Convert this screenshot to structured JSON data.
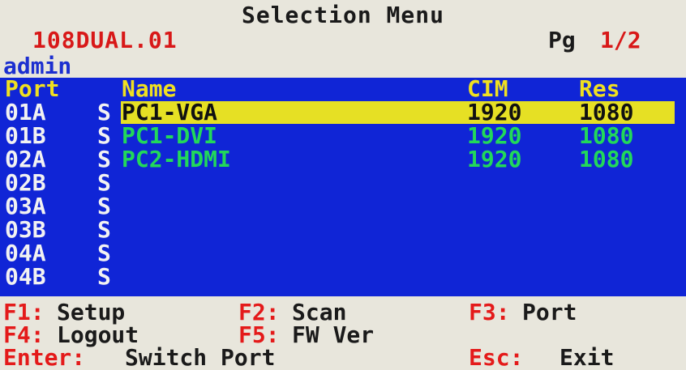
{
  "title": "Selection Menu",
  "model": "108DUAL.01",
  "page": {
    "label": "Pg",
    "value": "1/2"
  },
  "user": "admin",
  "columns": {
    "port": "Port",
    "name": "Name",
    "cim": "CIM",
    "res": "Res"
  },
  "rows": [
    {
      "port": "01A",
      "flag": "S",
      "name": "PC1-VGA",
      "cim": "1920",
      "res": "1080",
      "selected": true
    },
    {
      "port": "01B",
      "flag": "S",
      "name": "PC1-DVI",
      "cim": "1920",
      "res": "1080"
    },
    {
      "port": "02A",
      "flag": "S",
      "name": "PC2-HDMI",
      "cim": "1920",
      "res": "1080"
    },
    {
      "port": "02B",
      "flag": "S",
      "name": "",
      "cim": "",
      "res": ""
    },
    {
      "port": "03A",
      "flag": "S",
      "name": "",
      "cim": "",
      "res": ""
    },
    {
      "port": "03B",
      "flag": "S",
      "name": "",
      "cim": "",
      "res": ""
    },
    {
      "port": "04A",
      "flag": "S",
      "name": "",
      "cim": "",
      "res": ""
    },
    {
      "port": "04B",
      "flag": "S",
      "name": "",
      "cim": "",
      "res": ""
    }
  ],
  "shortcuts": {
    "setup": {
      "key": "F1:",
      "label": "Setup"
    },
    "scan": {
      "key": "F2:",
      "label": "Scan"
    },
    "port": {
      "key": "F3:",
      "label": "Port"
    },
    "logout": {
      "key": "F4:",
      "label": "Logout"
    },
    "fwver": {
      "key": "F5:",
      "label": "FW Ver"
    },
    "switch": {
      "key": "Enter:",
      "label": "Switch Port"
    },
    "exit": {
      "key": "Esc:",
      "label": "Exit"
    }
  },
  "colors": {
    "background": "#e8e6dc",
    "table": "#1025d6",
    "header_text": "#f0e020",
    "highlight": "#e6e024",
    "name_text": "#22d85a",
    "port_text": "#f2f2f2",
    "accent_red": "#d81818",
    "user_text": "#1c2fd0"
  }
}
